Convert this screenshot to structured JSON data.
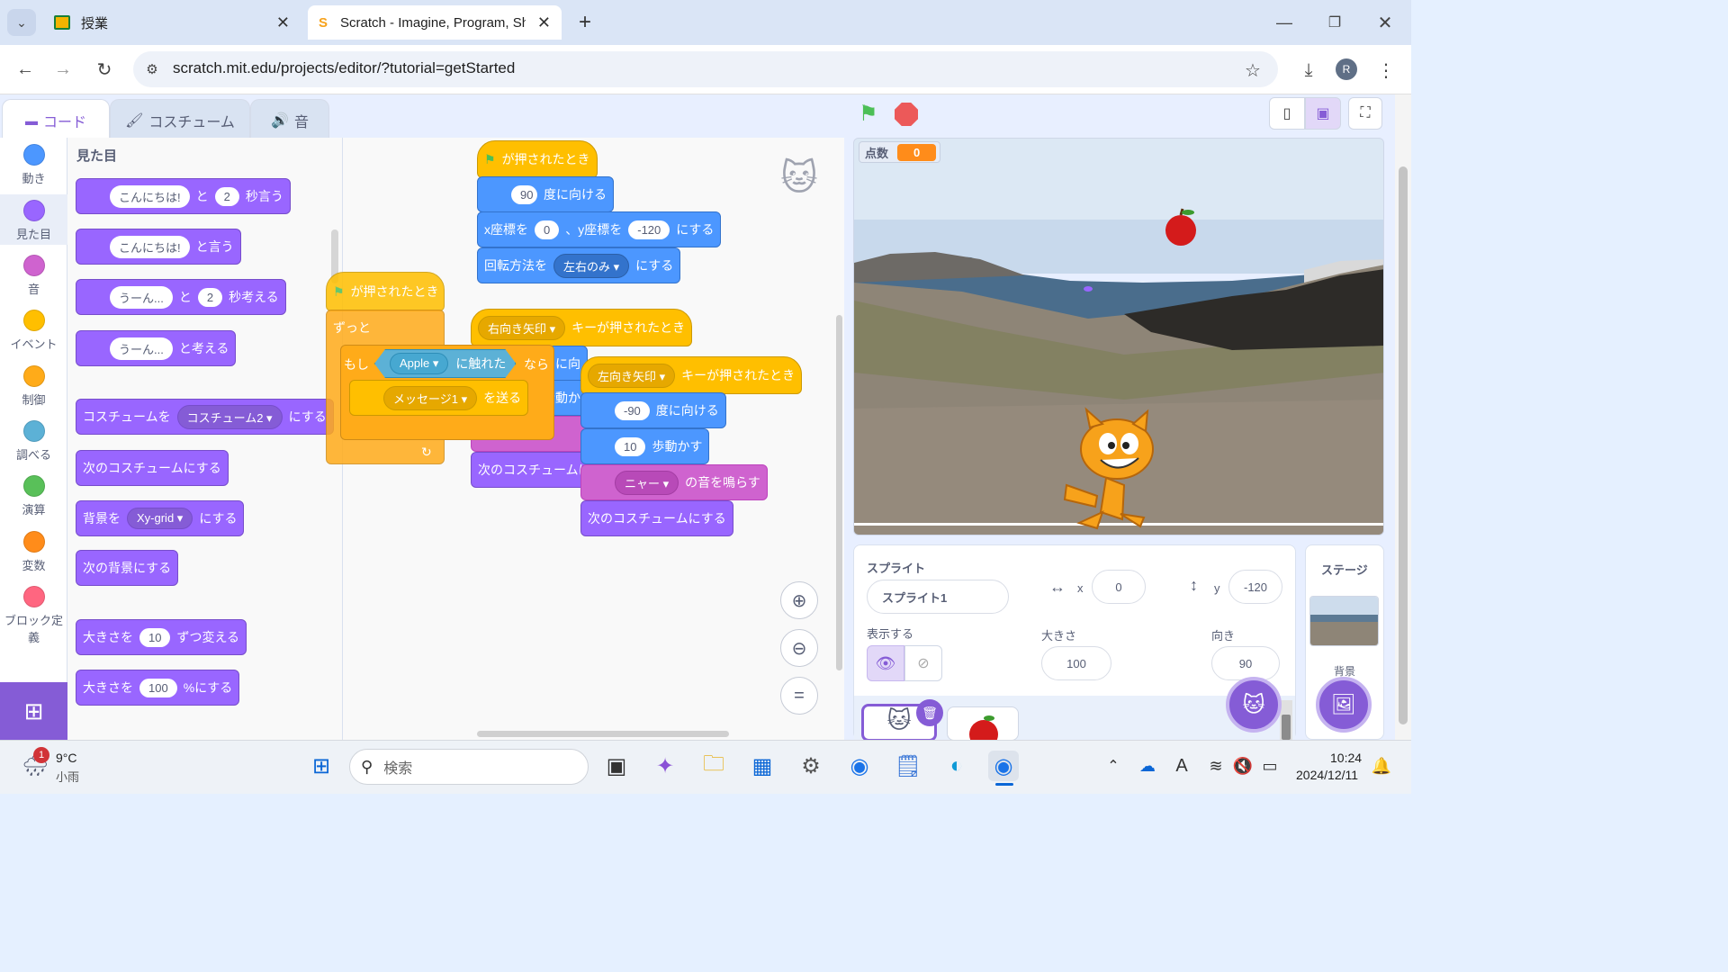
{
  "browser": {
    "tabs": [
      {
        "title": "授業"
      },
      {
        "title": "Scratch - Imagine, Program, Sha"
      }
    ],
    "url": "scratch.mit.edu/projects/editor/?tutorial=getStarted",
    "profile_initial": "R"
  },
  "editor_tabs": {
    "code": "コード",
    "costumes": "コスチューム",
    "sounds": "音"
  },
  "categories": [
    {
      "label": "動き",
      "color": "#4c97ff"
    },
    {
      "label": "見た目",
      "color": "#9966ff"
    },
    {
      "label": "音",
      "color": "#cf63cf"
    },
    {
      "label": "イベント",
      "color": "#ffbf00"
    },
    {
      "label": "制御",
      "color": "#ffab19"
    },
    {
      "label": "調べる",
      "color": "#5cb1d6"
    },
    {
      "label": "演算",
      "color": "#59c059"
    },
    {
      "label": "変数",
      "color": "#ff8c1a"
    },
    {
      "label": "ブロック定義",
      "color": "#ff6680"
    }
  ],
  "palette": {
    "title": "見た目",
    "say_secs": {
      "text": "こんにちは!",
      "to": "と",
      "secs": "2",
      "suffix": "秒言う"
    },
    "say": {
      "text": "こんにちは!",
      "suffix": "と言う"
    },
    "think_secs": {
      "text": "うーん...",
      "to": "と",
      "secs": "2",
      "suffix": "秒考える"
    },
    "think": {
      "text": "うーん...",
      "suffix": "と考える"
    },
    "switch_costume": {
      "prefix": "コスチュームを",
      "value": "コスチューム2",
      "suffix": "にする"
    },
    "next_costume": "次のコスチュームにする",
    "switch_backdrop": {
      "prefix": "背景を",
      "value": "Xy-grid",
      "suffix": "にする"
    },
    "next_backdrop": "次の背景にする",
    "change_size": {
      "prefix": "大きさを",
      "value": "10",
      "suffix": "ずつ変える"
    },
    "set_size": {
      "prefix": "大きさを",
      "value": "100",
      "suffix": "%にする"
    }
  },
  "script1": {
    "hat": "が押されたとき",
    "point": {
      "value": "90",
      "suffix": "度に向ける"
    },
    "goto": {
      "x_label": "x座標を",
      "x": "0",
      "sep": "、y座標を",
      "y": "-120",
      "suffix": "にする"
    },
    "rotation": {
      "prefix": "回転方法を",
      "value": "左右のみ",
      "suffix": "にする"
    }
  },
  "script2": {
    "hat": "が押されたとき",
    "forever": "ずっと",
    "if": "もし",
    "touching": {
      "value": "Apple",
      "suffix": "に触れた"
    },
    "then": "なら",
    "broadcast": {
      "value": "メッセージ1",
      "suffix": "を送る"
    }
  },
  "script3": {
    "key": "右向き矢印",
    "suffix": "キーが押されたとき",
    "partial1": "に向",
    "partial2": "歩動か",
    "partial3": "次のコスチュームに"
  },
  "script4": {
    "key": "左向き矢印",
    "suffix": "キーが押されたとき",
    "point": {
      "value": "-90",
      "suffix": "度に向ける"
    },
    "move": {
      "value": "10",
      "suffix": "歩動かす"
    },
    "sound": {
      "value": "ニャー",
      "suffix": "の音を鳴らす"
    },
    "next_costume": "次のコスチュームにする"
  },
  "stage": {
    "variable": {
      "name": "点数",
      "value": "0"
    }
  },
  "sprite_info": {
    "header": "スプライト",
    "name": "スプライト1",
    "x_label": "x",
    "x": "0",
    "y_label": "y",
    "y": "-120",
    "show_label": "表示する",
    "size_label": "大きさ",
    "size": "100",
    "direction_label": "向き",
    "direction": "90"
  },
  "stage_selector": {
    "title": "ステージ",
    "backdrop_label": "背景"
  },
  "taskbar": {
    "weather_temp": "9°C",
    "weather_desc": "小雨",
    "weather_badge": "1",
    "search_placeholder": "検索",
    "time": "10:24",
    "date": "2024/12/11"
  }
}
